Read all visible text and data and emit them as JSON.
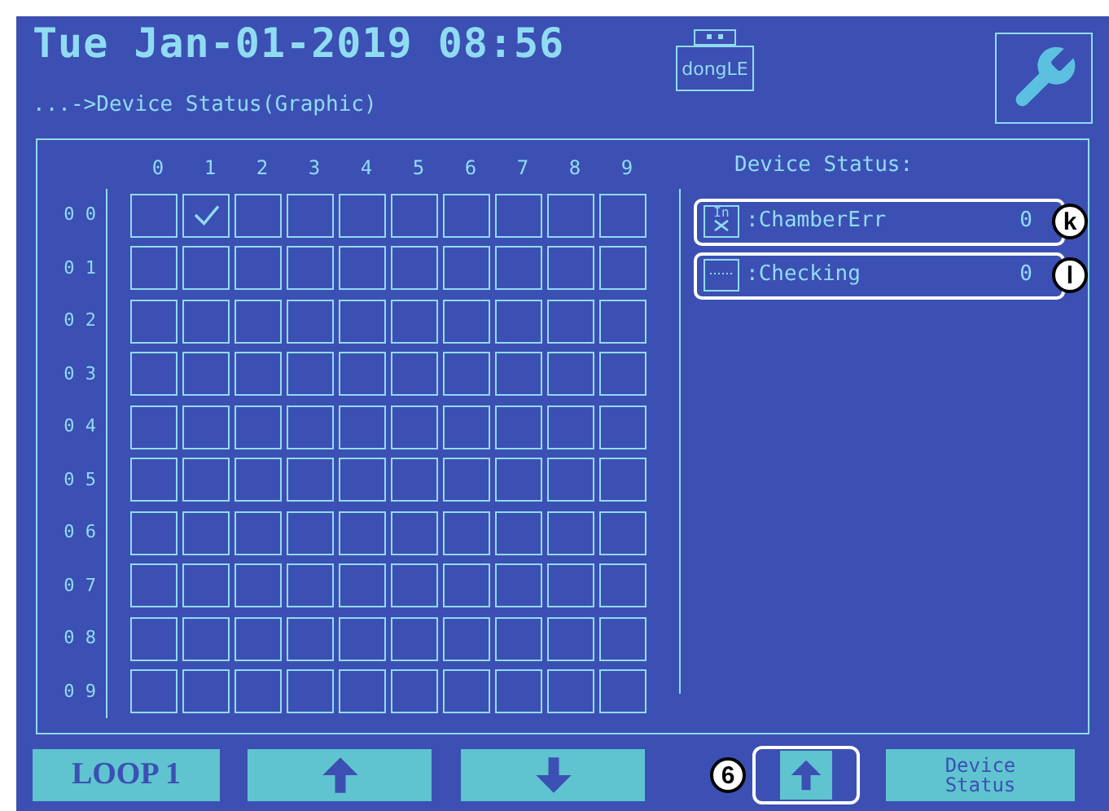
{
  "header": {
    "datetime": "Tue Jan-01-2019 08:56",
    "dongle_label": "dongLE",
    "breadcrumb": "...->Device Status(Graphic)"
  },
  "grid": {
    "columns": [
      "0",
      "1",
      "2",
      "3",
      "4",
      "5",
      "6",
      "7",
      "8",
      "9"
    ],
    "rows": [
      {
        "label": "0 0",
        "cells": [
          false,
          true,
          false,
          false,
          false,
          false,
          false,
          false,
          false,
          false
        ]
      },
      {
        "label": "0 1",
        "cells": [
          false,
          false,
          false,
          false,
          false,
          false,
          false,
          false,
          false,
          false
        ]
      },
      {
        "label": "0 2",
        "cells": [
          false,
          false,
          false,
          false,
          false,
          false,
          false,
          false,
          false,
          false
        ]
      },
      {
        "label": "0 3",
        "cells": [
          false,
          false,
          false,
          false,
          false,
          false,
          false,
          false,
          false,
          false
        ]
      },
      {
        "label": "0 4",
        "cells": [
          false,
          false,
          false,
          false,
          false,
          false,
          false,
          false,
          false,
          false
        ]
      },
      {
        "label": "0 5",
        "cells": [
          false,
          false,
          false,
          false,
          false,
          false,
          false,
          false,
          false,
          false
        ]
      },
      {
        "label": "0 6",
        "cells": [
          false,
          false,
          false,
          false,
          false,
          false,
          false,
          false,
          false,
          false
        ]
      },
      {
        "label": "0 7",
        "cells": [
          false,
          false,
          false,
          false,
          false,
          false,
          false,
          false,
          false,
          false
        ]
      },
      {
        "label": "0 8",
        "cells": [
          false,
          false,
          false,
          false,
          false,
          false,
          false,
          false,
          false,
          false
        ]
      },
      {
        "label": "0 9",
        "cells": [
          false,
          false,
          false,
          false,
          false,
          false,
          false,
          false,
          false,
          false
        ]
      }
    ]
  },
  "status_panel": {
    "title": "Device Status:",
    "items": [
      {
        "kind": "chamber_error",
        "icon_label": "In",
        "label": ":ChamberErr",
        "count": "0",
        "callout": "k"
      },
      {
        "kind": "checking",
        "label": ":Checking",
        "count": "0",
        "callout": "l"
      }
    ]
  },
  "bottom_bar": {
    "loop_label": "LOOP 1",
    "callout": "6",
    "device_status_label": "Device Status"
  }
}
